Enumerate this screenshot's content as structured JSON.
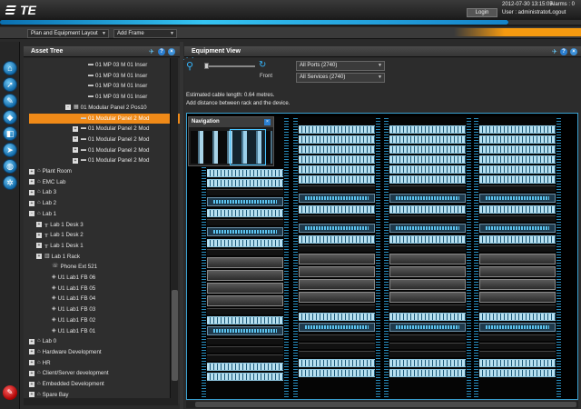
{
  "header": {
    "logo_text": "TE",
    "login_label": "Login",
    "datetime": "2012-07-30 13:15:05",
    "alarms": "Alarms : 0",
    "user": "User : administrator",
    "logout_label": "Logout"
  },
  "toolbar": {
    "layout_select": "Plan and Equipment Layout",
    "frame_select": "Add Frame"
  },
  "asset_tree": {
    "title": "Asset Tree",
    "rows": [
      {
        "label": "01 MP 03 M 01 Inser",
        "level": 9,
        "icon": "▬",
        "exp": ""
      },
      {
        "label": "01 MP 03 M 01 Inser",
        "level": 9,
        "icon": "▬",
        "exp": ""
      },
      {
        "label": "01 MP 03 M 01 Inser",
        "level": 9,
        "icon": "▬",
        "exp": ""
      },
      {
        "label": "01 MP 03 M 01 Inser",
        "level": 9,
        "icon": "▬",
        "exp": ""
      },
      {
        "label": "01 Modular Panel 2 Pos10",
        "level": 7,
        "icon": "▦",
        "exp": "-"
      },
      {
        "label": "01 Modular Panel 2 Mod",
        "level": 8,
        "icon": "▬",
        "exp": "",
        "selected": true
      },
      {
        "label": "01 Modular Panel 2 Mod",
        "level": 8,
        "icon": "▬",
        "exp": "+"
      },
      {
        "label": "01 Modular Panel 2 Mod",
        "level": 8,
        "icon": "▬",
        "exp": "+"
      },
      {
        "label": "01 Modular Panel 2 Mod",
        "level": 8,
        "icon": "▬",
        "exp": "+"
      },
      {
        "label": "01 Modular Panel 2 Mod",
        "level": 8,
        "icon": "▬",
        "exp": "+"
      },
      {
        "label": "Plant Room",
        "level": 2,
        "icon": "⌂",
        "exp": "+"
      },
      {
        "label": "EMC Lab",
        "level": 2,
        "icon": "⌂",
        "exp": "+"
      },
      {
        "label": "Lab 3",
        "level": 2,
        "icon": "⌂",
        "exp": "+"
      },
      {
        "label": "Lab 2",
        "level": 2,
        "icon": "⌂",
        "exp": "+"
      },
      {
        "label": "Lab 1",
        "level": 2,
        "icon": "⌂",
        "exp": "-"
      },
      {
        "label": "Lab 1 Desk 3",
        "level": 3,
        "icon": "╥",
        "exp": "+"
      },
      {
        "label": "Lab 1 Desk 2",
        "level": 3,
        "icon": "╥",
        "exp": "+"
      },
      {
        "label": "Lab 1 Desk 1",
        "level": 3,
        "icon": "╥",
        "exp": "+"
      },
      {
        "label": "Lab 1 Rack",
        "level": 3,
        "icon": "▥",
        "exp": "+"
      },
      {
        "label": "Phone Ext 521",
        "level": 4,
        "icon": "☏",
        "exp": ""
      },
      {
        "label": "U1 Lab1 FB 06",
        "level": 4,
        "icon": "◈",
        "exp": ""
      },
      {
        "label": "U1 Lab1 FB 05",
        "level": 4,
        "icon": "◈",
        "exp": ""
      },
      {
        "label": "U1 Lab1 FB 04",
        "level": 4,
        "icon": "◈",
        "exp": ""
      },
      {
        "label": "U1 Lab1 FB 03",
        "level": 4,
        "icon": "◈",
        "exp": ""
      },
      {
        "label": "U1 Lab1 FB 02",
        "level": 4,
        "icon": "◈",
        "exp": ""
      },
      {
        "label": "U1 Lab1 FB 01",
        "level": 4,
        "icon": "◈",
        "exp": ""
      },
      {
        "label": "Lab 0",
        "level": 2,
        "icon": "⌂",
        "exp": "+"
      },
      {
        "label": "Hardware Development",
        "level": 2,
        "icon": "⌂",
        "exp": "+"
      },
      {
        "label": "HR",
        "level": 2,
        "icon": "⌂",
        "exp": "+"
      },
      {
        "label": "Client/Server development",
        "level": 2,
        "icon": "⌂",
        "exp": "+"
      },
      {
        "label": "Embedded Development",
        "level": 2,
        "icon": "⌂",
        "exp": "+"
      },
      {
        "label": "Spare Bay",
        "level": 2,
        "icon": "⌂",
        "exp": "+"
      }
    ]
  },
  "equipment_view": {
    "title": "Equipment View",
    "front_label": "Front",
    "ports_select": "All Ports (2740)",
    "services_select": "All Services (2740)",
    "cable_length": "Estimated cable length: 0.64 metres.",
    "distance_note": "Add distance between rack and the device.",
    "navigation_title": "Navigation"
  },
  "colors": {
    "accent_blue": "#35b7ff",
    "selection_orange": "#f08a18"
  }
}
